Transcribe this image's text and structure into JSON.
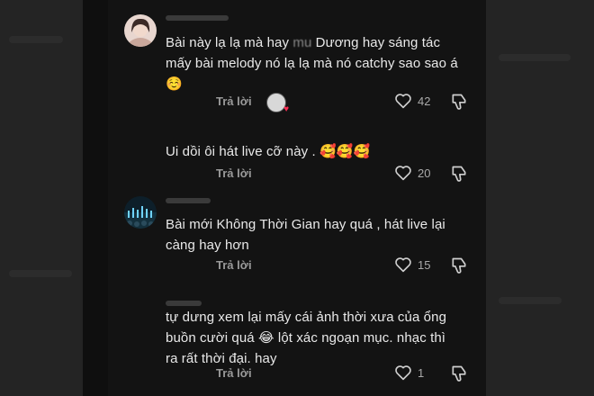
{
  "comments": [
    {
      "text_line1_pre": "Bài này lạ lạ mà hay ",
      "text_line1_blur": "mu",
      "text_line1_post": " Dương hay sáng tác",
      "text_line2": "mấy bài melody nó lạ lạ mà nó catchy sao sao á",
      "emoji": "☺️",
      "reply_label": "Trả lời",
      "likes": "42",
      "creator_liked": true
    },
    {
      "text_line1": "Ui dồi ôi hát live cỡ này . 🥰🥰🥰",
      "reply_label": "Trả lời",
      "likes": "20"
    },
    {
      "text_line1": "Bài mới Không Thời Gian hay quá , hát live lại",
      "text_line2": "càng hay hơn",
      "reply_label": "Trả lời",
      "likes": "15"
    },
    {
      "text_line1": "tự dưng xem lại mấy cái ảnh thời xưa của ổng",
      "text_line2": "buồn cười quá 😂 lột xác ngoạn mục. nhạc thì",
      "text_line3": "ra rất thời đại. hay",
      "reply_label": "Trả lời",
      "likes": "1"
    }
  ],
  "icons": {
    "like": "heart-outline-icon",
    "dislike": "thumbs-down-icon"
  },
  "colors": {
    "background": "#0f0f0f",
    "text": "#e9e9e9",
    "muted": "#9a9a9a",
    "heart": "#ff2d55"
  }
}
